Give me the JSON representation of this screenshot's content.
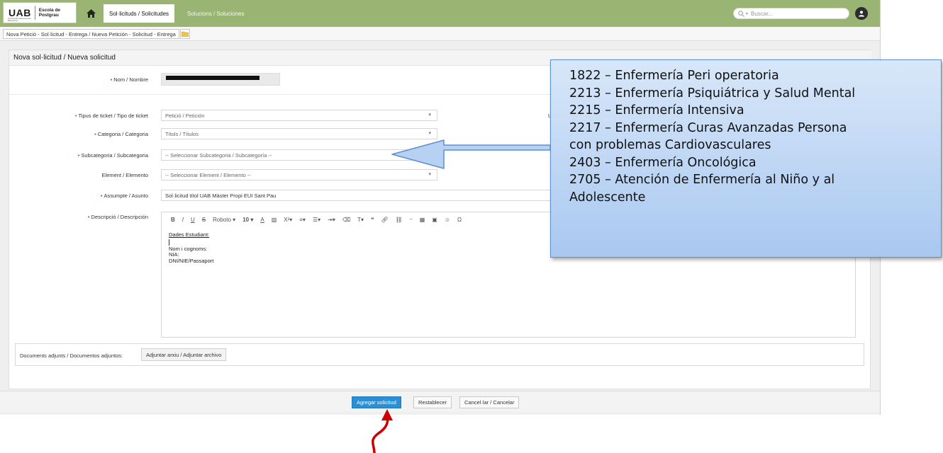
{
  "topbar": {
    "logo": "UAB",
    "logo_sub": "Universitat Autònoma de Barcelona",
    "school": "Escola de Postgrau",
    "tabs": [
      {
        "label": "Sol·licituds / Solicitudes",
        "active": true
      },
      {
        "label": "Solucions / Soluciones",
        "active": false
      }
    ],
    "search_placeholder": "Buscar..."
  },
  "breadcrumb": "Nova Petició - Sol·licitud - Entrega / Nueva Petición - Solicitud - Entrega",
  "form": {
    "title": "Nova sol·licitud / Nueva solicitud",
    "name_label": "Nom / Nombre",
    "ticket_type_label": "Tipus de ticket / Tipo de ticket",
    "ticket_type_value": "Petició / Petición",
    "category_label": "Categoria / Categoria",
    "category_value": "Títols / Títulos",
    "subcategory_label": "Subcategoria / Subcategoria",
    "subcategory_value": "-- Seleccionar Subcategoria / Subcategoría --",
    "element_label": "Element / Elemento",
    "element_value": "-- Seleccionar Element / Elemento --",
    "subject_label": "Assumpte / Asunto",
    "subject_value": "Sol·licitud títol UAB Màster Propi EUI Sant Pau",
    "description_label": "Descripció / Descripción",
    "side_letter": "U",
    "editor_font": "Roboto",
    "editor_size": "10",
    "editor_lines": [
      "Dades Estudiant:",
      "Nom i cognoms:",
      "NIA:",
      "DNI/NIE/Passaport"
    ],
    "attachments_label": "Documents adjunts / Documentos adjuntos:",
    "attach_button": "Adjuntar arxiu / Adjuntar archivo"
  },
  "actions": {
    "submit": "Agregar solicitud",
    "reset": "Restablecer",
    "cancel": "Cancel·lar / Cancelar"
  },
  "callout": {
    "lines": [
      "1822 – Enfermería Peri operatoria",
      "2213 – Enfermería Psiquiátrica y Salud Mental",
      "2215 – Enfermería Intensiva",
      "2217 – Enfermería Curas Avanzadas Persona",
      "con problemas Cardiovasculares",
      "2403 – Enfermería Oncológica",
      "2705 – Atención de Enfermería al Niño y al",
      "Adolescente"
    ]
  },
  "colors": {
    "topbar": "#9ab474",
    "primary_button": "#2b8fd6",
    "callout_border": "#5c8fd1",
    "annotation_arrow": "#cc0000"
  }
}
